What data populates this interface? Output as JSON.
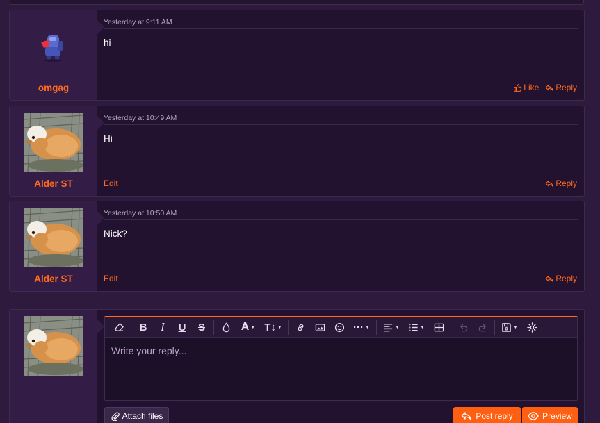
{
  "colors": {
    "background": "#2d1a3d",
    "accent": "#ff6a1f",
    "panel": "#221230",
    "user_cell": "#331d46"
  },
  "messages": [
    {
      "username": "omgag",
      "avatar": "robot-avatar",
      "date": "Yesterday at 9:11 AM",
      "body": "hi",
      "actions_left": [],
      "actions_right": [
        {
          "label": "Like",
          "icon": "thumbs-up-icon"
        },
        {
          "label": "Reply",
          "icon": "reply-icon"
        }
      ]
    },
    {
      "username": "Alder ST",
      "avatar": "guinea-pig-photo",
      "date": "Yesterday at 10:49 AM",
      "body": "Hi",
      "actions_left": [
        {
          "label": "Edit"
        }
      ],
      "actions_right": [
        {
          "label": "Reply",
          "icon": "reply-icon"
        }
      ]
    },
    {
      "username": "Alder ST",
      "avatar": "guinea-pig-photo",
      "date": "Yesterday at 10:50 AM",
      "body": "Nick?",
      "actions_left": [
        {
          "label": "Edit"
        }
      ],
      "actions_right": [
        {
          "label": "Reply",
          "icon": "reply-icon"
        }
      ]
    }
  ],
  "reply": {
    "placeholder": "Write your reply...",
    "attach_label": "Attach files",
    "post_label": "Post reply",
    "preview_label": "Preview",
    "toolbar_icons": [
      "remove-formatting-icon",
      "bold-icon",
      "italic-icon",
      "underline-icon",
      "strikethrough-icon",
      "text-color-icon",
      "font-family-icon",
      "font-size-icon",
      "link-icon",
      "image-icon",
      "emoji-icon",
      "more-options-icon",
      "align-icon",
      "list-icon",
      "table-icon",
      "undo-icon",
      "redo-icon",
      "drafts-icon",
      "settings-icon"
    ]
  }
}
